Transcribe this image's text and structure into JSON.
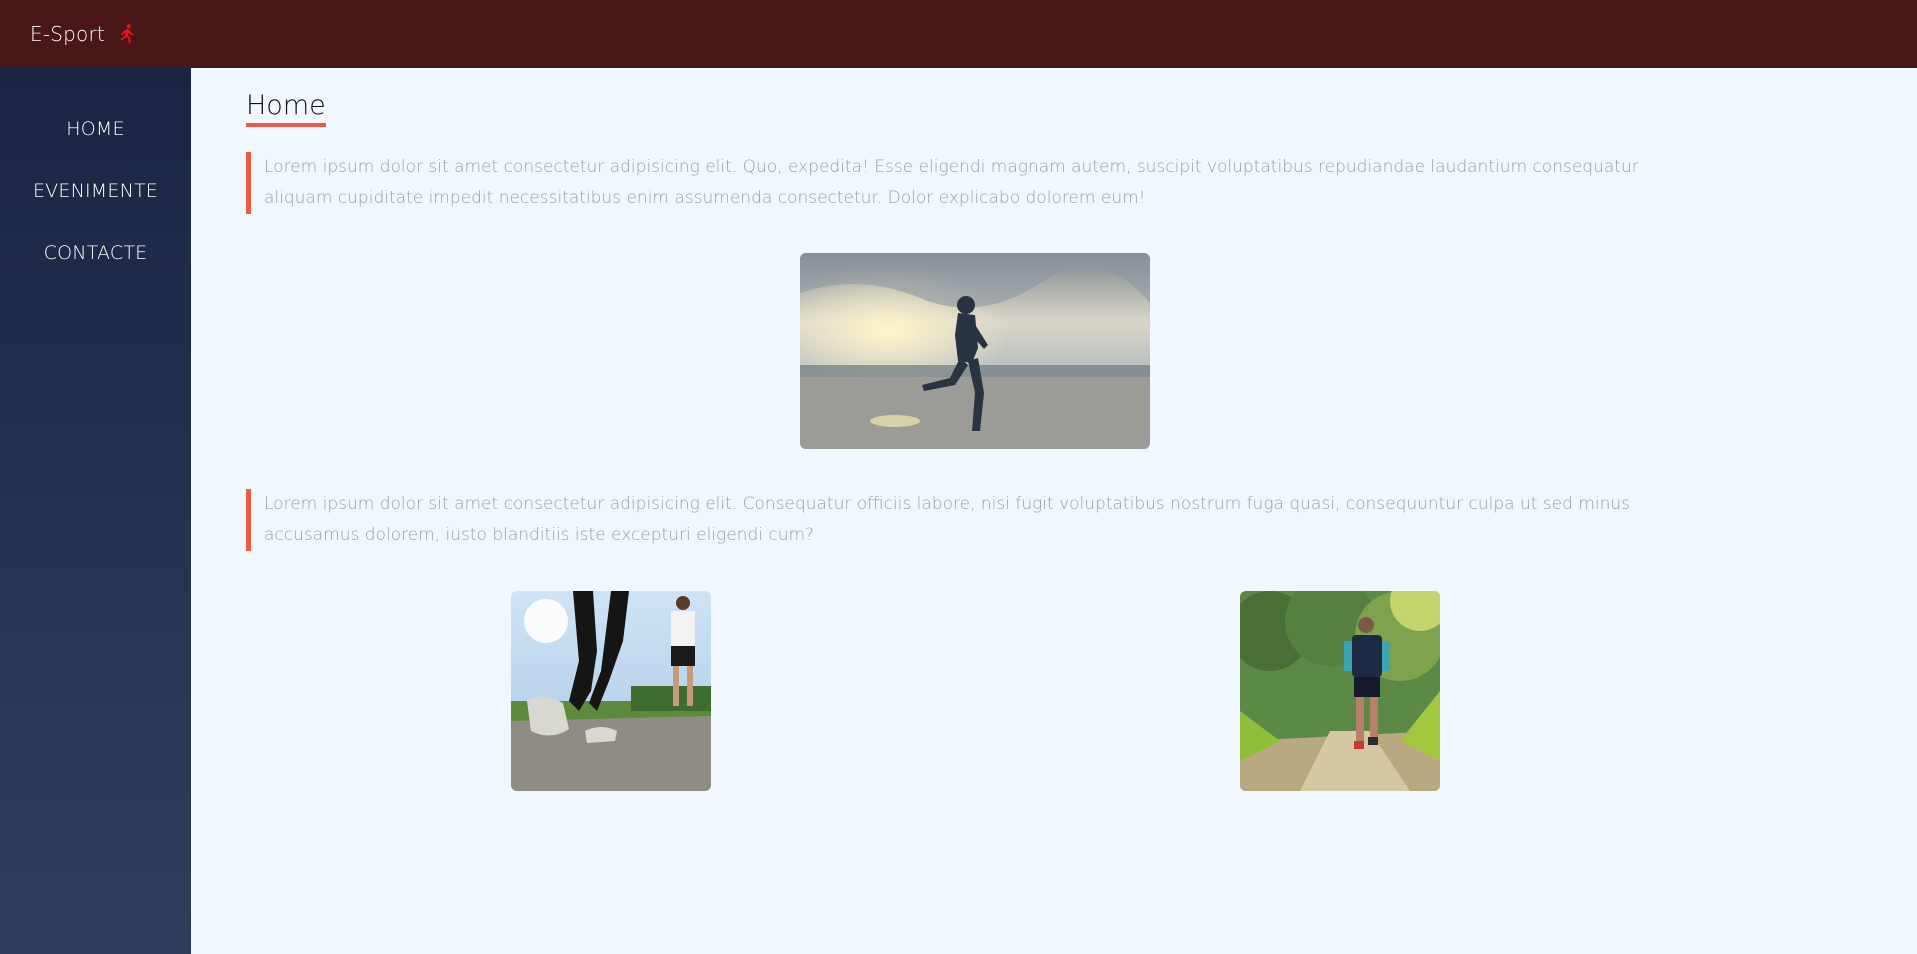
{
  "header": {
    "brand": "E-Sport",
    "brand_icon": "running-person-icon",
    "brand_icon_color": "#e8131b",
    "background": "#4a1719"
  },
  "sidebar": {
    "items": [
      {
        "label": "HOME"
      },
      {
        "label": "EVENIMENTE"
      },
      {
        "label": "CONTACTE"
      }
    ]
  },
  "main": {
    "title": "Home",
    "accent_color": "#ef5a44",
    "paragraphs": [
      "Lorem ipsum dolor sit amet consectetur adipisicing elit. Quo, expedita! Esse eligendi magnam autem, suscipit voluptatibus repudiandae laudantium consequatur aliquam cupiditate impedit necessitatibus enim assumenda consectetur. Dolor explicabo dolorem eum!",
      "Lorem ipsum dolor sit amet consectetur adipisicing elit. Consequatur officiis labore, nisi fugit voluptatibus nostrum fuga quasi, consequuntur culpa ut sed minus accusamus dolorem, iusto blanditiis iste excepturi eligendi cum?"
    ],
    "images": [
      {
        "name": "beach-runner-photo"
      },
      {
        "name": "road-runners-photo"
      },
      {
        "name": "trail-runner-photo"
      }
    ]
  }
}
